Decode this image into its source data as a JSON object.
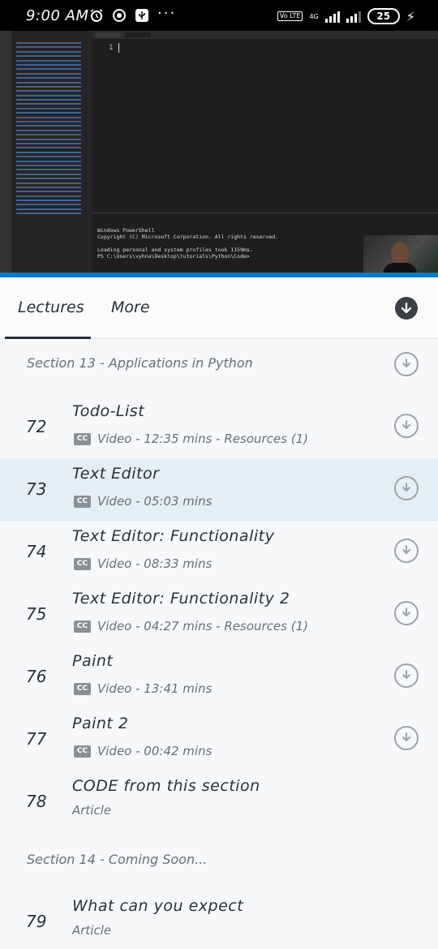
{
  "status_bar": {
    "time": "9:00 AM",
    "battery": "25",
    "network": "4G",
    "volte": "Vo LTE"
  },
  "video": {
    "line_number": "1",
    "terminal_lines": [
      "Windows PowerShell",
      "Copyright (C) Microsoft Corporation. All rights reserved.",
      "",
      "Loading personal and system profiles took 1159ms.",
      "PS C:\\Users\\vyhna\\Desktop\\tutorials\\Python\\Code>"
    ]
  },
  "tabs": {
    "lectures": "Lectures",
    "more": "More"
  },
  "sections": [
    {
      "title": "Section 13 - Applications in Python"
    },
    {
      "title": "Section 14 - Coming Soon..."
    }
  ],
  "lectures": [
    {
      "num": "72",
      "title": "Todo-List",
      "meta": "Video - 12:35 mins - Resources (1)"
    },
    {
      "num": "73",
      "title": "Text Editor",
      "meta": "Video - 05:03 mins"
    },
    {
      "num": "74",
      "title": "Text Editor: Functionality",
      "meta": "Video - 08:33 mins"
    },
    {
      "num": "75",
      "title": "Text Editor: Functionality 2",
      "meta": "Video - 04:27 mins - Resources (1)"
    },
    {
      "num": "76",
      "title": "Paint",
      "meta": "Video - 13:41 mins"
    },
    {
      "num": "77",
      "title": "Paint 2",
      "meta": "Video - 00:42 mins"
    },
    {
      "num": "78",
      "title": "CODE from this section",
      "meta": "Article"
    },
    {
      "num": "79",
      "title": "What can you expect",
      "meta": "Article"
    }
  ],
  "icons": {
    "cc": "CC",
    "download": "↓"
  },
  "colors": {
    "active_row": "#e4eef4",
    "text_dark": "#29303b",
    "text_muted": "#686f7a",
    "editor_bg": "#1e1e1e",
    "status_blue": "#007acc"
  }
}
